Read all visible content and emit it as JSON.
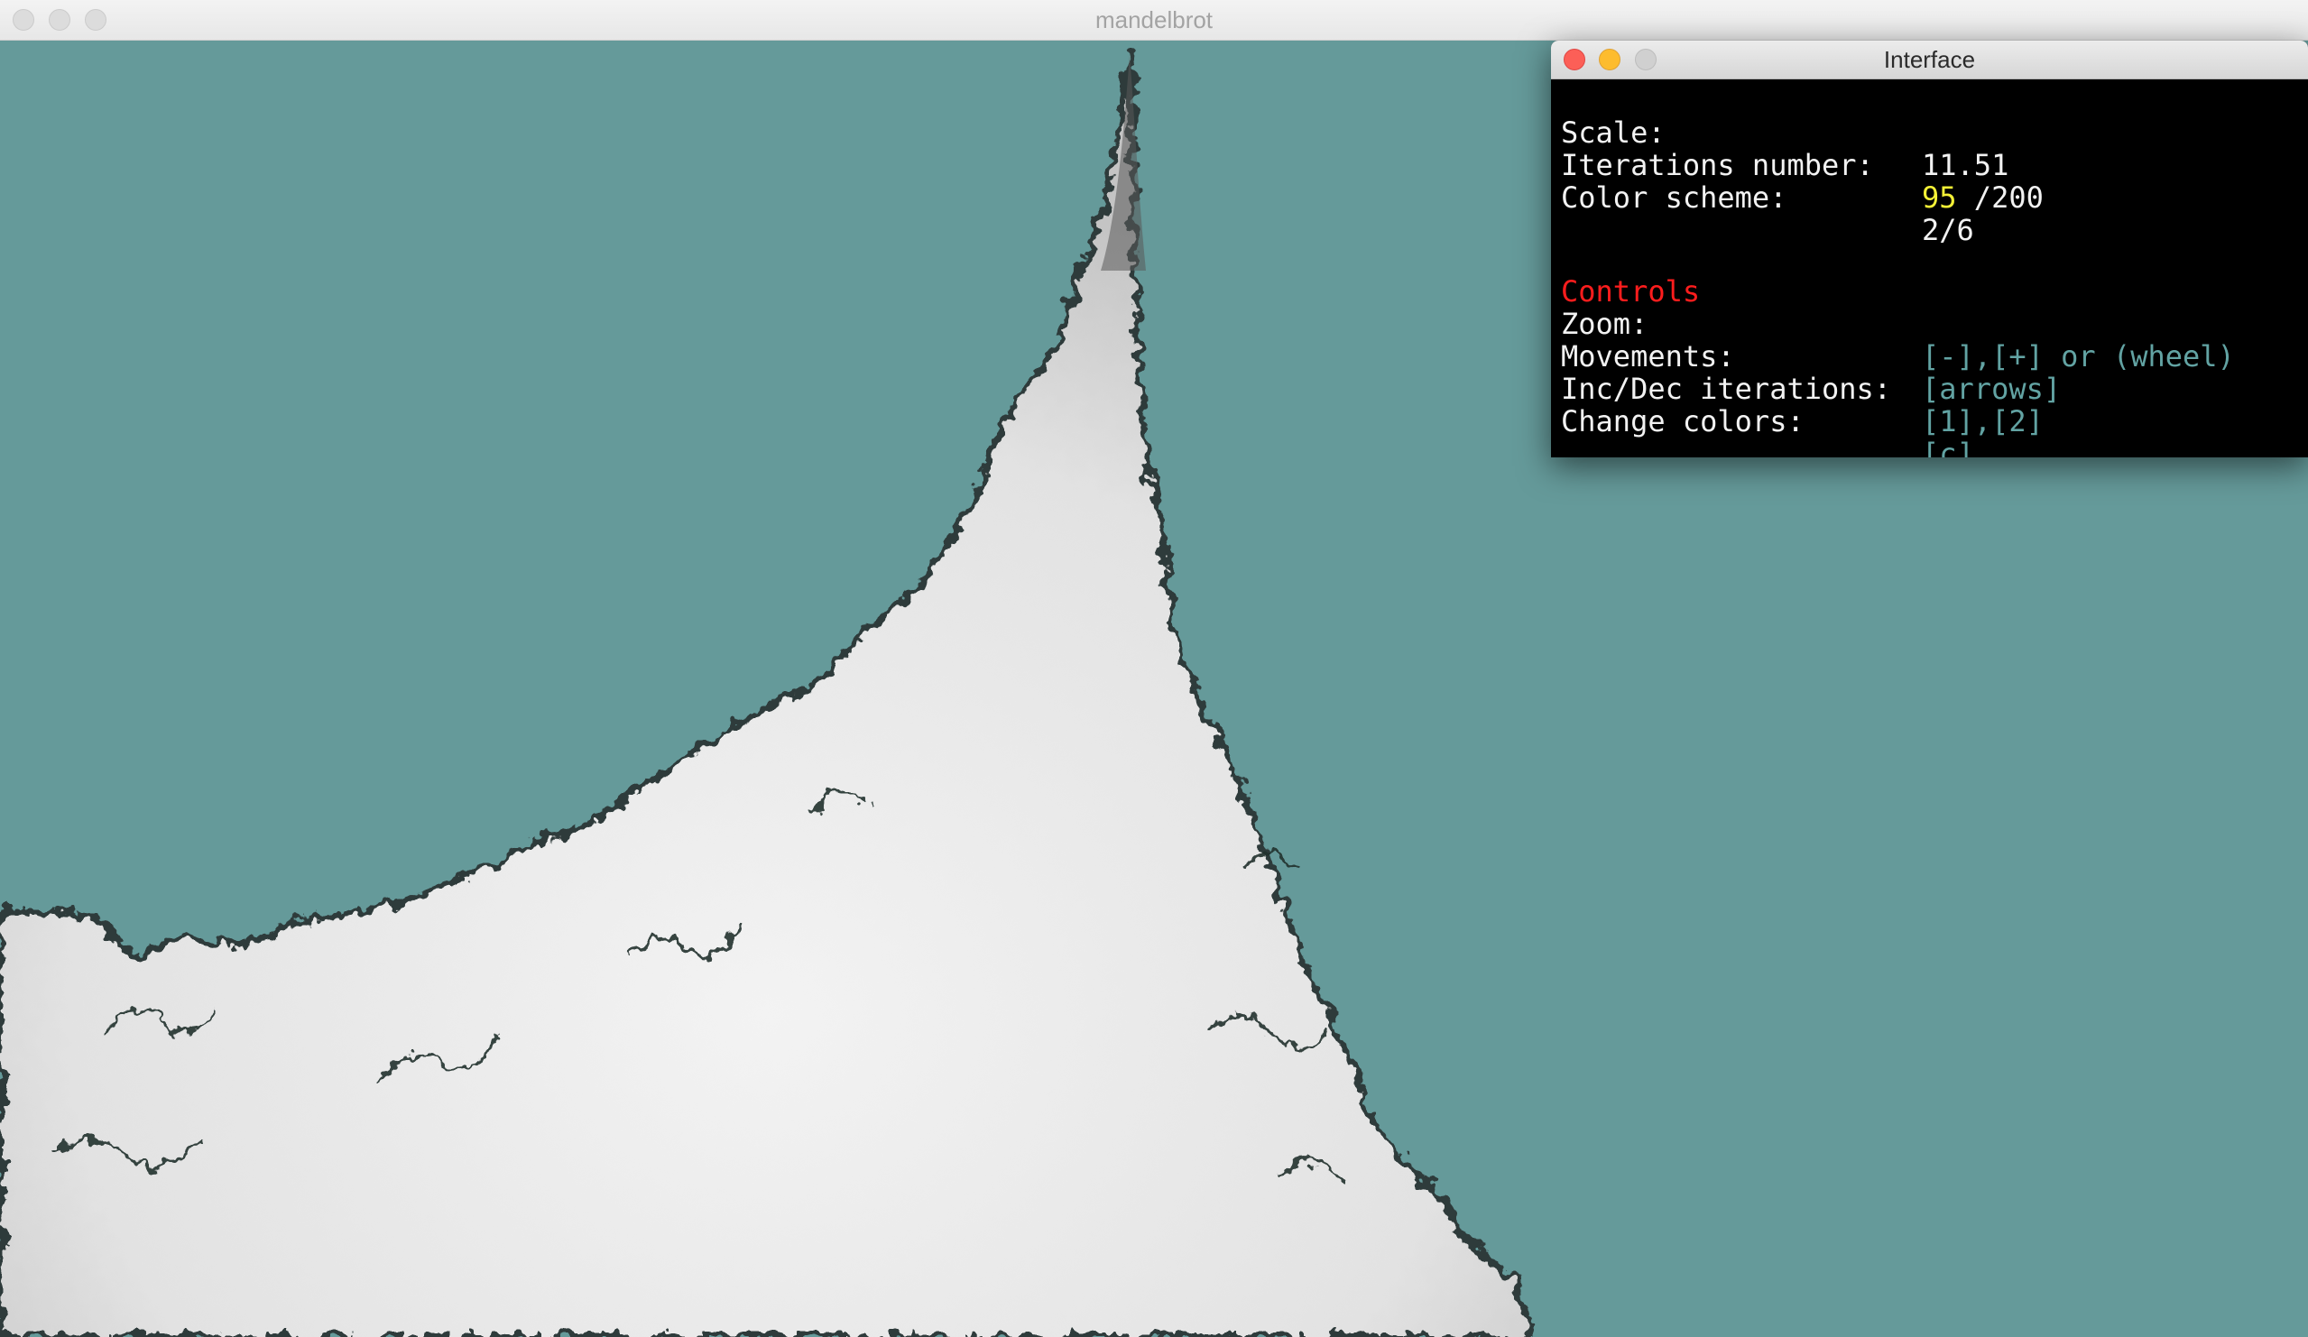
{
  "window": {
    "title": "mandelbrot"
  },
  "interface": {
    "title": "Interface",
    "stats": {
      "scale_label": "Scale:",
      "scale_value": "11.51",
      "iterations_label": "Iterations number:",
      "iterations_current": "95",
      "iterations_max": " /200",
      "color_scheme_label": "Color scheme:",
      "color_scheme_value": "2/6"
    },
    "controls": {
      "heading": "Controls",
      "zoom_label": "Zoom:",
      "zoom_keys": "[-],[+] or (wheel)",
      "movements_label": "Movements:",
      "movements_keys": "[arrows]",
      "iterations_label": "Inc/Dec iterations:",
      "iterations_keys": "[1],[2]",
      "colors_label": "Change colors:",
      "colors_keys": "[c]"
    }
  },
  "colors": {
    "background": "#659a9a",
    "fractal_light": "#f1f1f1",
    "fractal_dark": "#1f2b2b",
    "highlight_yellow": "#f4f136",
    "heading_red": "#ff1d1d",
    "key_teal": "#62a3a3"
  }
}
